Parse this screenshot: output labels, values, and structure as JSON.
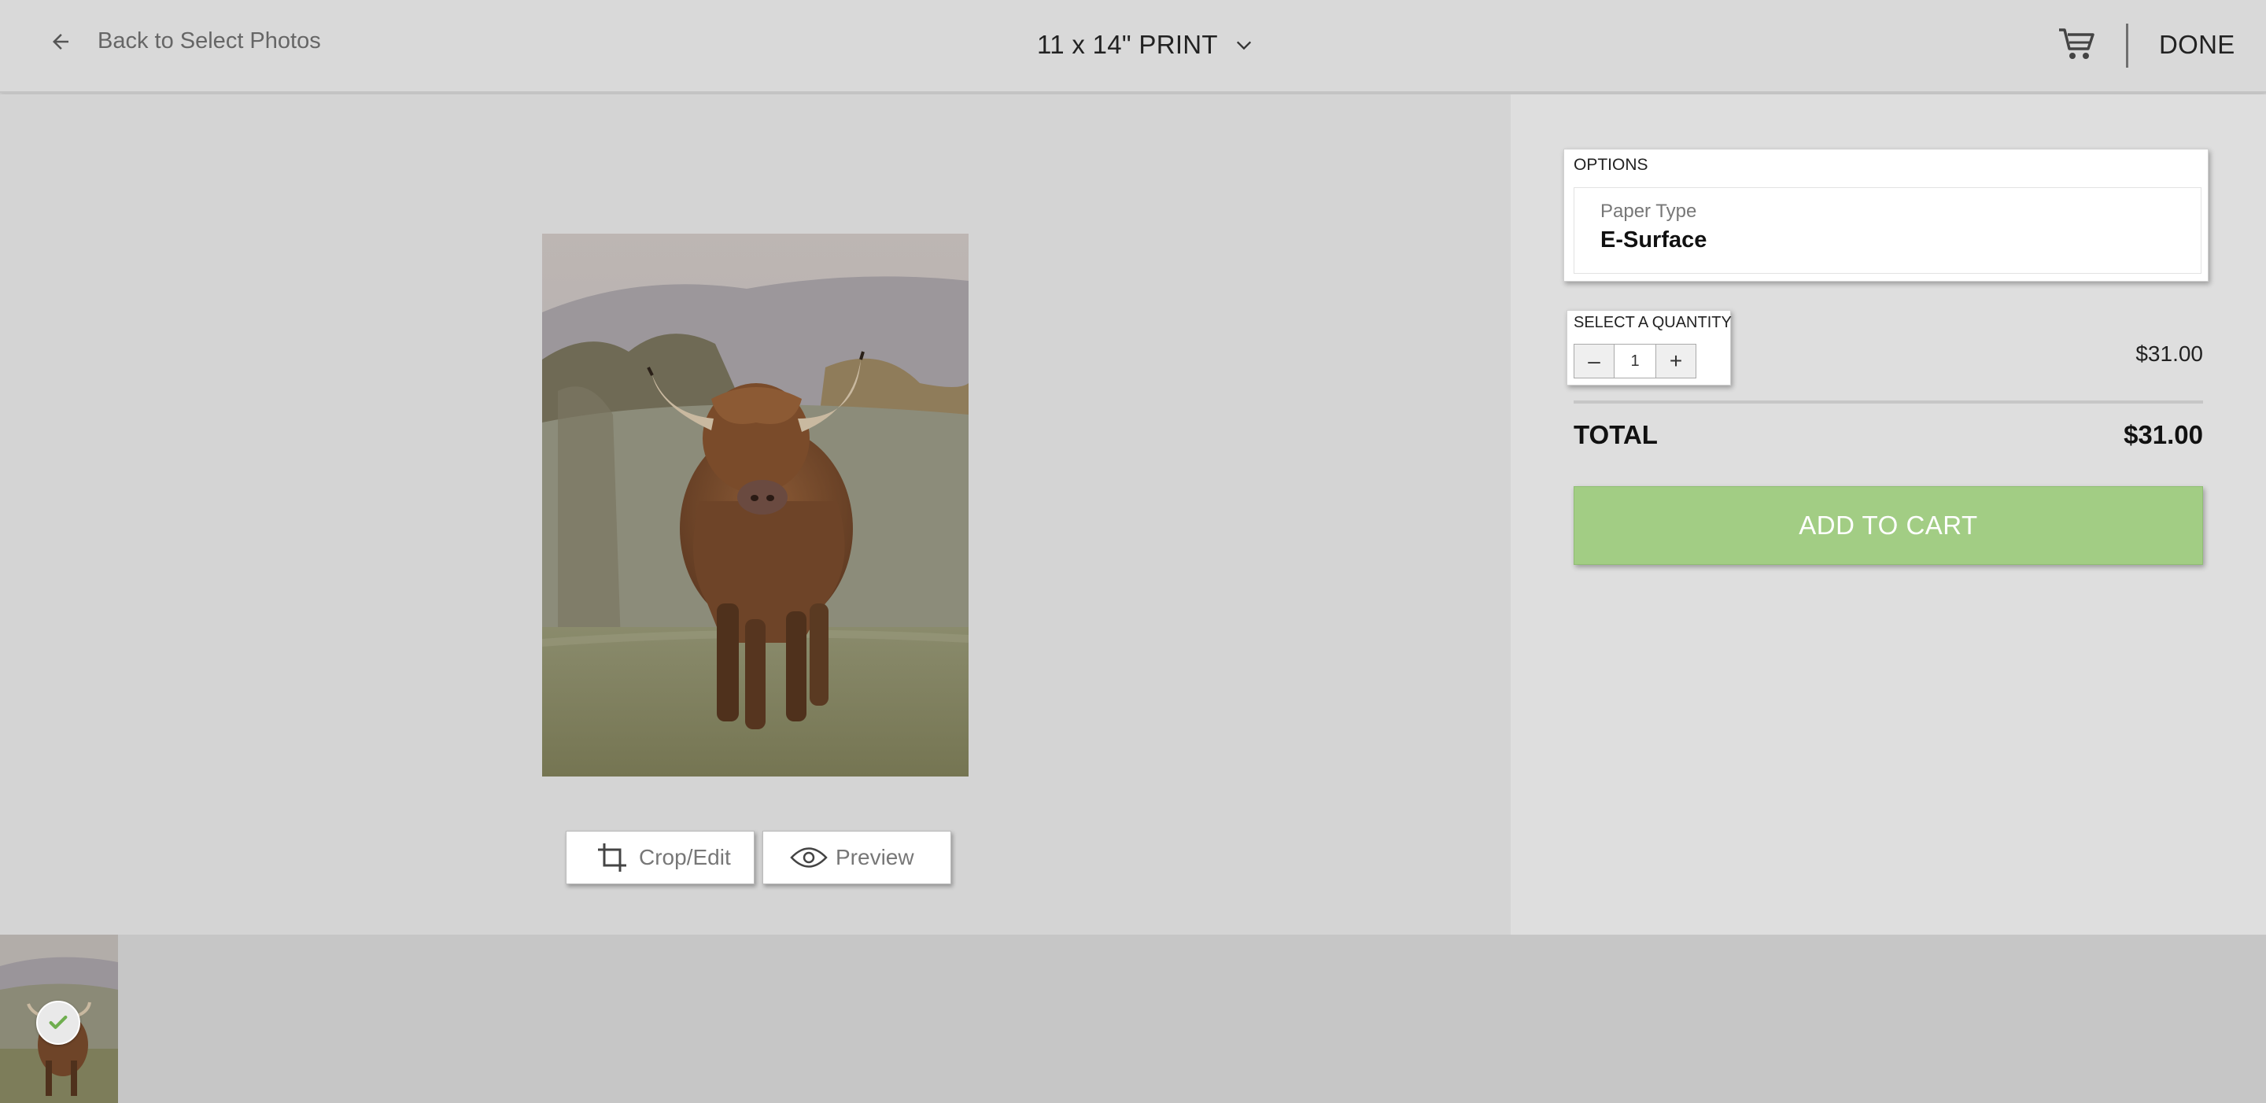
{
  "header": {
    "back_label": "Back to Select Photos",
    "product_label": "11 x 14\" PRINT",
    "done_label": "DONE"
  },
  "photo_tools": {
    "crop_label": "Crop/Edit",
    "preview_label": "Preview"
  },
  "options": {
    "title": "OPTIONS",
    "paper_type_label": "Paper Type",
    "paper_type_value": "E-Surface"
  },
  "quantity": {
    "title": "SELECT A QUANTITY",
    "minus": "–",
    "plus": "+",
    "value": "1",
    "unit_price": "$31.00"
  },
  "total": {
    "label": "TOTAL",
    "value": "$31.00"
  },
  "add_to_cart_label": "ADD TO CART",
  "colors": {
    "add_to_cart_bg": "#a2cd84",
    "check_color": "#6fae4f",
    "header_bg": "#d9d9d9",
    "panel_bg": "#dedede"
  },
  "icons": [
    "arrow-left-icon",
    "chevron-down-icon",
    "cart-icon",
    "crop-icon",
    "eye-icon",
    "check-icon"
  ]
}
